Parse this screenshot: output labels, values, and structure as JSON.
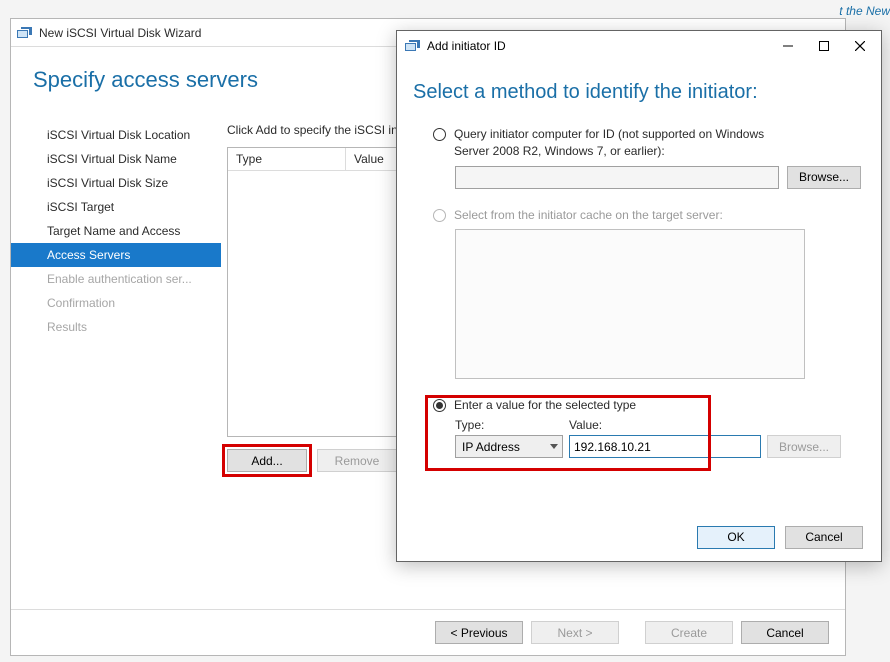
{
  "bg_link": "t the New",
  "wizard": {
    "title": "New iSCSI Virtual Disk Wizard",
    "heading": "Specify access servers",
    "nav": [
      {
        "label": "iSCSI Virtual Disk Location",
        "state": "normal"
      },
      {
        "label": "iSCSI Virtual Disk Name",
        "state": "normal"
      },
      {
        "label": "iSCSI Virtual Disk Size",
        "state": "normal"
      },
      {
        "label": "iSCSI Target",
        "state": "normal"
      },
      {
        "label": "Target Name and Access",
        "state": "normal"
      },
      {
        "label": "Access Servers",
        "state": "selected"
      },
      {
        "label": "Enable authentication ser...",
        "state": "disabled"
      },
      {
        "label": "Confirmation",
        "state": "disabled"
      },
      {
        "label": "Results",
        "state": "disabled"
      }
    ],
    "instruction": "Click Add to specify the iSCSI ini",
    "grid": {
      "columns": {
        "type": "Type",
        "value": "Value"
      }
    },
    "actions": {
      "add": "Add...",
      "remove": "Remove"
    },
    "footer": {
      "previous": "< Previous",
      "next": "Next >",
      "create": "Create",
      "cancel": "Cancel"
    }
  },
  "dialog": {
    "title": "Add initiator ID",
    "heading": "Select a method to identify the initiator:",
    "opt1": {
      "label": "Query initiator computer for ID (not supported on Windows Server 2008 R2, Windows 7, or earlier):",
      "browse": "Browse..."
    },
    "opt2": {
      "label": "Select from the initiator cache on the target server:"
    },
    "opt3": {
      "label": "Enter a value for the selected type",
      "type_label": "Type:",
      "value_label": "Value:",
      "type_selected": "IP Address",
      "value": "192.168.10.21",
      "browse": "Browse..."
    },
    "footer": {
      "ok": "OK",
      "cancel": "Cancel"
    }
  }
}
